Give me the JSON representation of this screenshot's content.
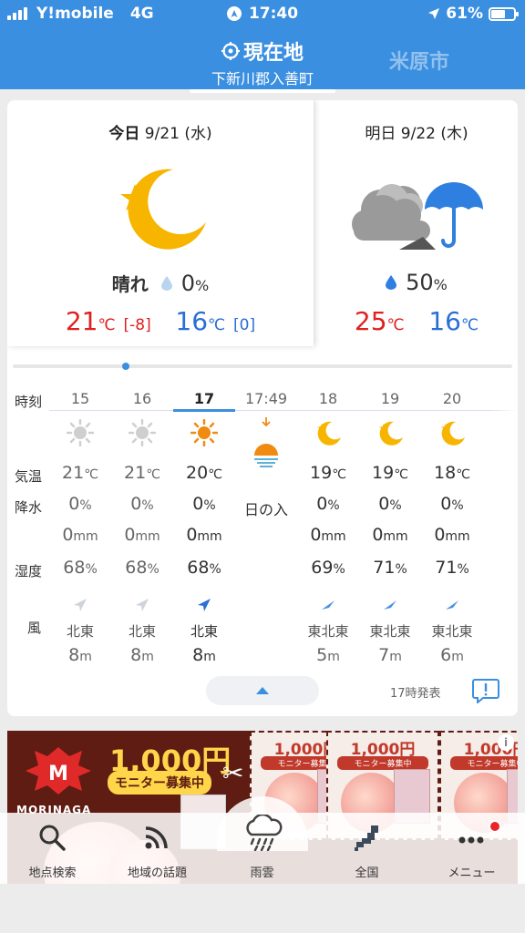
{
  "status_bar": {
    "carrier": "Y!mobile",
    "network": "4G",
    "time": "17:40",
    "battery": "61%",
    "battery_level": 0.61
  },
  "header": {
    "current_tab_title": "現在地",
    "current_tab_subtitle": "下新川郡入善町",
    "other_tab": "米原市"
  },
  "today": {
    "label": "今日",
    "date": "9/21 (水)",
    "weather": "晴れ",
    "rain_chance": "0",
    "rain_unit": "%",
    "high": "21",
    "high_diff": "[-8]",
    "low": "16",
    "low_diff": "[0]",
    "unit": "℃",
    "icon": "moon-star-icon"
  },
  "tomorrow": {
    "date": "明日 9/22 (木)",
    "rain_chance": "50",
    "rain_unit": "%",
    "high": "25",
    "low": "16",
    "unit": "℃",
    "icon": "cloud-umbrella-icon"
  },
  "hourly": {
    "row_labels": [
      "時刻",
      "気温",
      "降水",
      "湿度",
      "風"
    ],
    "columns": [
      {
        "hour": "15",
        "icon": "sun-gray-icon",
        "temp": "21",
        "precip": "0",
        "amount": "0",
        "humidity": "68",
        "wind_dir": "北東",
        "wind_speed": "8"
      },
      {
        "hour": "16",
        "icon": "sun-gray-icon",
        "temp": "21",
        "precip": "0",
        "amount": "0",
        "humidity": "68",
        "wind_dir": "北東",
        "wind_speed": "8"
      },
      {
        "hour": "17",
        "icon": "sun-orange-icon",
        "temp": "20",
        "precip": "0",
        "amount": "0",
        "humidity": "68",
        "wind_dir": "北東",
        "wind_speed": "8"
      },
      {
        "hour": "17:49",
        "icon": "sunset-icon",
        "event": "日の入"
      },
      {
        "hour": "18",
        "icon": "moon-icon",
        "temp": "19",
        "precip": "0",
        "amount": "0",
        "humidity": "69",
        "wind_dir": "東北東",
        "wind_speed": "5"
      },
      {
        "hour": "19",
        "icon": "moon-icon",
        "temp": "19",
        "precip": "0",
        "amount": "0",
        "humidity": "71",
        "wind_dir": "東北東",
        "wind_speed": "7"
      },
      {
        "hour": "20",
        "icon": "moon-icon",
        "temp": "18",
        "precip": "0",
        "amount": "0",
        "humidity": "71",
        "wind_dir": "東北東",
        "wind_speed": "6"
      }
    ],
    "temp_unit": "℃",
    "precip_unit": "%",
    "amount_unit": "mm",
    "humidity_unit": "%",
    "wind_unit": "m",
    "issued": "17時発表"
  },
  "ad": {
    "brand": "MORINAGA",
    "price": "1,000円",
    "monitor": "モニター募集中",
    "coupon_price": "1,000円",
    "coupon_text": "モニター募集中"
  },
  "bottom_nav": [
    {
      "label": "地点検索",
      "icon": "search-icon"
    },
    {
      "label": "地域の話題",
      "icon": "rss-icon"
    },
    {
      "label": "雨雲",
      "icon": "rain-cloud-icon"
    },
    {
      "label": "全国",
      "icon": "japan-map-icon"
    },
    {
      "label": "メニュー",
      "icon": "more-icon"
    }
  ],
  "colors": {
    "accent": "#3b8fe0",
    "high_temp": "#e02020",
    "low_temp": "#2a6fd6",
    "sun": "#f7b500"
  }
}
